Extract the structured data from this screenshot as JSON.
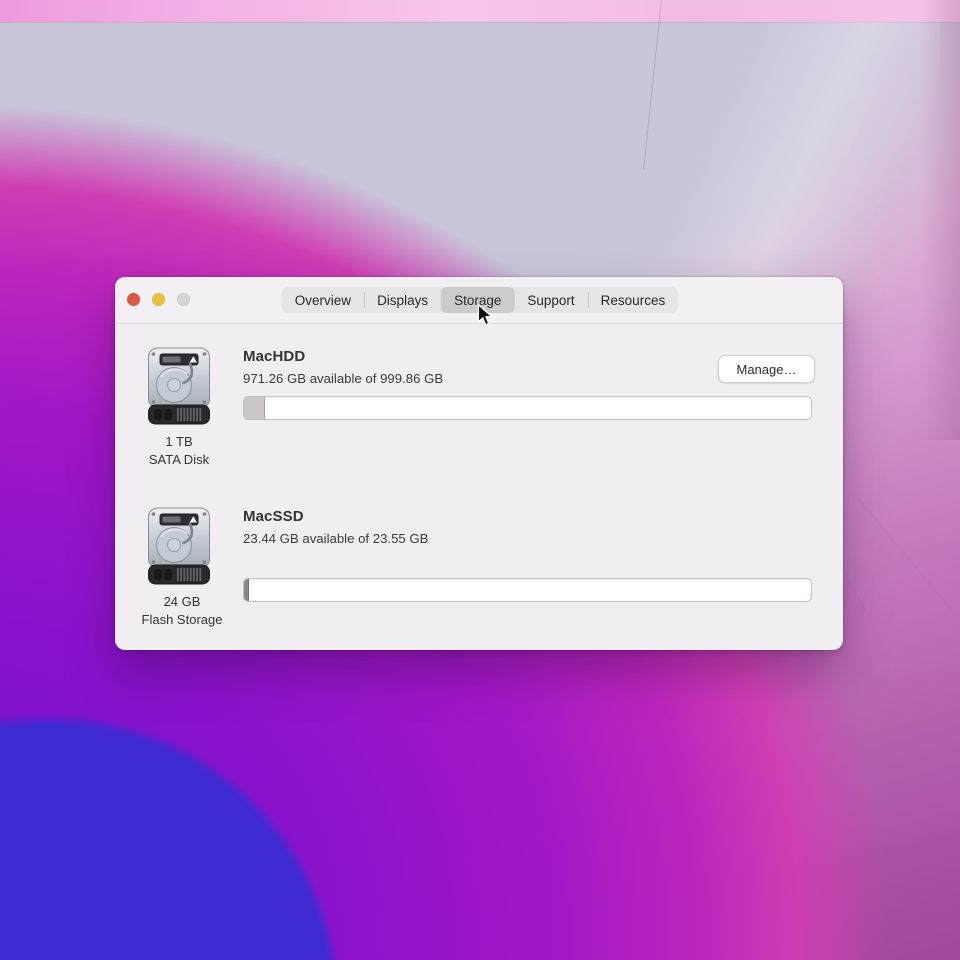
{
  "wallpaper": {
    "style": "macos-monterey-abstract-photo",
    "colors": {
      "top_band_pink": "#f3b0e5",
      "lavender": "#c9c6da",
      "magenta": "#bc27bc",
      "deep_purple": "#8912cb",
      "blue_circle": "#3e2ad2",
      "bottom_right_pink": "#b863b0"
    }
  },
  "window": {
    "traffic_lights": {
      "close_color": "#dd5744",
      "minimize_color": "#e8c23e",
      "zoom_disabled_color": "#d7d4d4"
    },
    "tabs": [
      {
        "label": "Overview",
        "selected": false
      },
      {
        "label": "Displays",
        "selected": false
      },
      {
        "label": "Storage",
        "selected": true
      },
      {
        "label": "Support",
        "selected": false
      },
      {
        "label": "Resources",
        "selected": false
      }
    ],
    "disks": [
      {
        "name": "MacHDD",
        "availability": "971.26 GB available of 999.86 GB",
        "capacity": "1 TB",
        "kind": "SATA Disk",
        "used_width": "3.6%",
        "used_color": "#c9c6c9",
        "manage_label": "Manage…"
      },
      {
        "name": "MacSSD",
        "availability": "23.44 GB available of 23.55 GB",
        "capacity": "24 GB",
        "kind": "Flash Storage",
        "used_width": "0.7%",
        "used_color": "#8a888c"
      }
    ]
  },
  "icons": {
    "disk": "internal-hard-drive-icon",
    "cursor": "mouse-arrow-cursor"
  }
}
